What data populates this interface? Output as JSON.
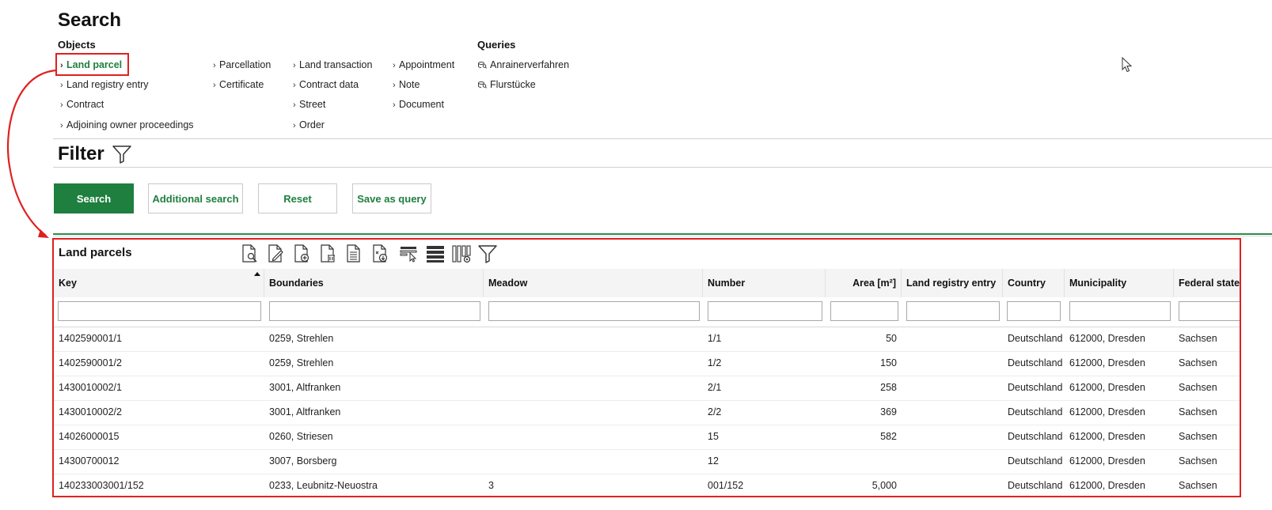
{
  "page": {
    "title": "Search",
    "objects_label": "Objects",
    "queries_label": "Queries",
    "filter_title": "Filter"
  },
  "objects": [
    {
      "label": "Land parcel",
      "active": true
    },
    {
      "label": "Land registry entry"
    },
    {
      "label": "Contract"
    },
    {
      "label": "Adjoining owner proceedings"
    },
    {
      "label": "Parcellation"
    },
    {
      "label": "Certificate"
    },
    {
      "label": "Land transaction"
    },
    {
      "label": "Contract data"
    },
    {
      "label": "Street"
    },
    {
      "label": "Order"
    },
    {
      "label": "Appointment"
    },
    {
      "label": "Note"
    },
    {
      "label": "Document"
    }
  ],
  "queries": [
    {
      "label": "Anrainerverfahren",
      "icon": "database-search-icon"
    },
    {
      "label": "Flurstücke",
      "icon": "database-search-icon"
    }
  ],
  "filter": {
    "icon": "funnel-icon",
    "buttons": {
      "search": "Search",
      "additional_search": "Additional search",
      "reset": "Reset",
      "save_as_query": "Save as query"
    }
  },
  "results": {
    "title": "Land parcels",
    "toolbar_icons": [
      "view-document-icon",
      "edit-document-icon",
      "new-document-icon",
      "delete-document-icon",
      "document-icon",
      "export-document-icon",
      "highlight-select-icon",
      "list-view-icon",
      "column-settings-icon",
      "filter-icon"
    ],
    "columns": [
      "Key",
      "Boundaries",
      "Meadow",
      "Number",
      "Area [m²]",
      "Land registry entry",
      "Country",
      "Municipality",
      "Federal state"
    ],
    "sort": {
      "column": "Key",
      "direction": "ascending"
    },
    "rows": [
      [
        "1402590001/1",
        "0259, Strehlen",
        "",
        "1/1",
        "50",
        "",
        "Deutschland",
        "612000, Dresden",
        "Sachsen"
      ],
      [
        "1402590001/2",
        "0259, Strehlen",
        "",
        "1/2",
        "150",
        "",
        "Deutschland",
        "612000, Dresden",
        "Sachsen"
      ],
      [
        "1430010002/1",
        "3001, Altfranken",
        "",
        "2/1",
        "258",
        "",
        "Deutschland",
        "612000, Dresden",
        "Sachsen"
      ],
      [
        "1430010002/2",
        "3001, Altfranken",
        "",
        "2/2",
        "369",
        "",
        "Deutschland",
        "612000, Dresden",
        "Sachsen"
      ],
      [
        "14026000015",
        "0260, Striesen",
        "",
        "15",
        "582",
        "",
        "Deutschland",
        "612000, Dresden",
        "Sachsen"
      ],
      [
        "14300700012",
        "3007, Borsberg",
        "",
        "12",
        "",
        "",
        "Deutschland",
        "612000, Dresden",
        "Sachsen"
      ],
      [
        "140233003001/152",
        "0233, Leubnitz-Neuostra",
        "3",
        "001/152",
        "5,000",
        "",
        "Deutschland",
        "612000, Dresden",
        "Sachsen"
      ]
    ]
  },
  "colors": {
    "accent_green": "#1e7f3e",
    "highlight_red": "#e02020"
  }
}
